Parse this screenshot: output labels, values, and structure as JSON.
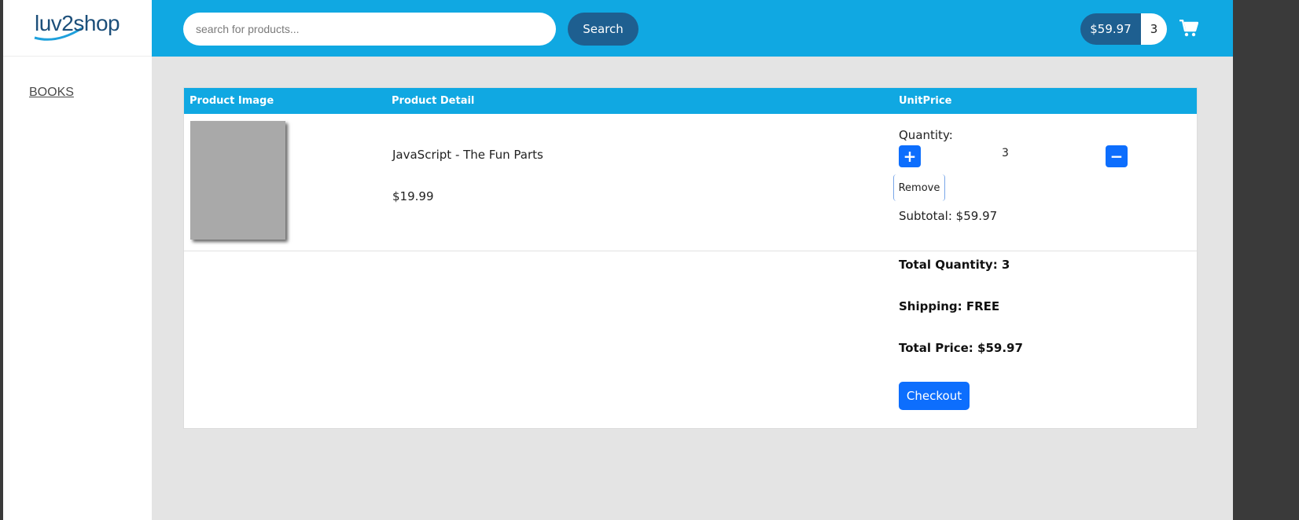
{
  "logo": {
    "text": "luv2shop"
  },
  "sidebar": {
    "items": [
      {
        "label": "BOOKS"
      }
    ]
  },
  "header": {
    "search": {
      "placeholder": "search for products...",
      "value": ""
    },
    "search_button_label": "Search",
    "cart_total": "$59.97",
    "cart_count": "3",
    "cart_icon": "shopping-cart-icon"
  },
  "table": {
    "headers": [
      "Product Image",
      "Product Detail",
      "UnitPrice"
    ],
    "items": [
      {
        "image_icon": "product-image-placeholder",
        "name": "JavaScript - The Fun Parts",
        "price": "$19.99",
        "quantity_label": "Quantity:",
        "quantity": "3",
        "plus_label": "+",
        "minus_label": "−",
        "remove_label": "Remove",
        "subtotal": "Subtotal: $59.97"
      }
    ]
  },
  "summary": {
    "total_quantity": "Total Quantity: 3",
    "shipping": "Shipping: FREE",
    "total_price": "Total Price: $59.97",
    "checkout_label": "Checkout"
  },
  "colors": {
    "header_bg": "#10a8e2",
    "dark_blue": "#1e5f90",
    "button_blue": "#0d6efd",
    "page_bg": "#e4e4e4"
  }
}
